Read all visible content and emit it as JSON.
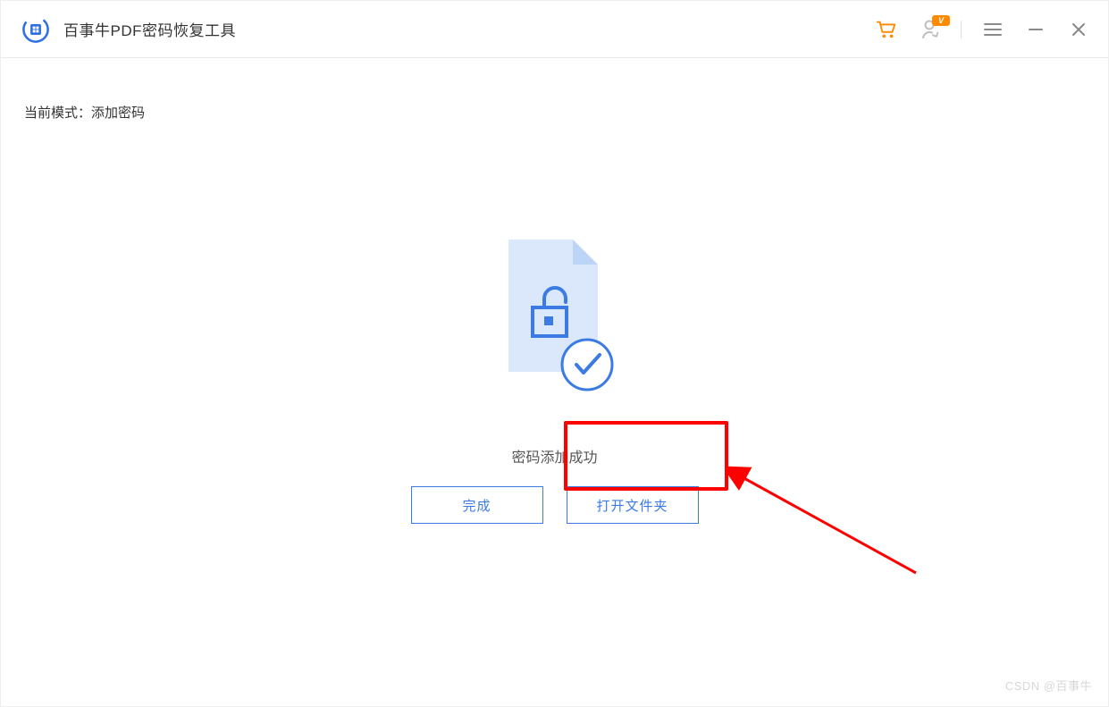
{
  "header": {
    "title": "百事牛PDF密码恢复工具"
  },
  "main": {
    "mode_label": "当前模式：",
    "mode_value": "添加密码",
    "status": "密码添加成功",
    "buttons": {
      "done": "完成",
      "open_folder": "打开文件夹"
    }
  },
  "watermark": "CSDN @百事牛",
  "colors": {
    "accent": "#3b7be3",
    "highlight": "#ff0000",
    "vip_badge": "#ff8a00"
  }
}
